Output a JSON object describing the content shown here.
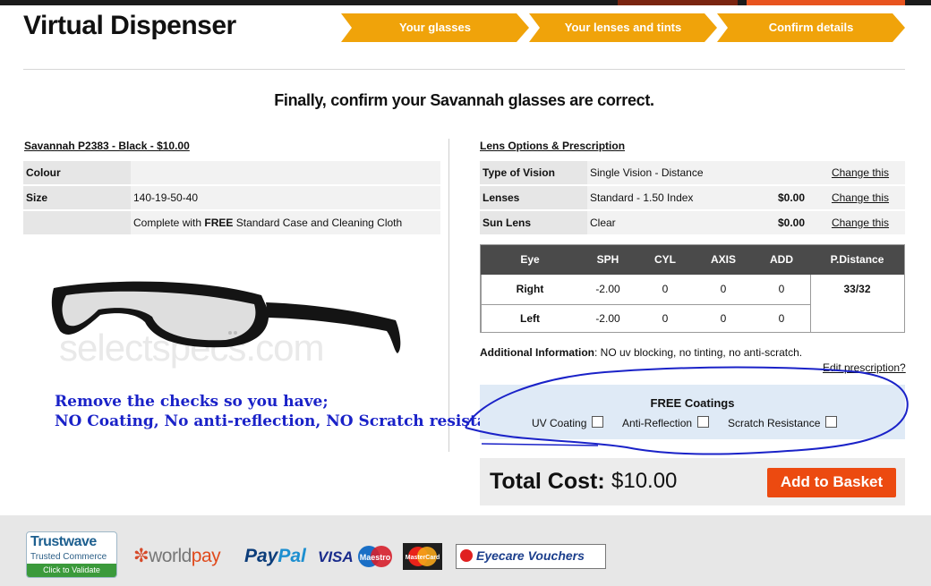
{
  "header": {
    "title": "Virtual Dispenser",
    "steps": [
      "Your glasses",
      "Your lenses and tints",
      "Confirm details"
    ]
  },
  "headline": "Finally, confirm your Savannah glasses are correct.",
  "frame": {
    "title": "Savannah P2383 - Black - $10.00",
    "rows": [
      {
        "label": "Colour",
        "value": ""
      },
      {
        "label": "Size",
        "value": "140-19-50-40"
      },
      {
        "label": "",
        "value_pre": "Complete with ",
        "value_bold": "FREE",
        "value_post": " Standard Case and Cleaning Cloth"
      }
    ],
    "watermark": "selectspecs.com"
  },
  "annotation": {
    "line1": "Remove the checks so you have;",
    "line2": "NO Coating, No anti-reflection, NO Scratch resistance >"
  },
  "lens": {
    "title": "Lens Options & Prescription",
    "rows": [
      {
        "label": "Type of Vision",
        "value": "Single Vision - Distance",
        "price": "",
        "link": "Change this"
      },
      {
        "label": "Lenses",
        "value": "Standard - 1.50 Index",
        "price": "$0.00",
        "link": "Change this"
      },
      {
        "label": "Sun Lens",
        "value": "Clear",
        "price": "$0.00",
        "link": "Change this"
      }
    ]
  },
  "prescription": {
    "headers": [
      "Eye",
      "SPH",
      "CYL",
      "AXIS",
      "ADD",
      "P.Distance"
    ],
    "rows": [
      {
        "eye": "Right",
        "sph": "-2.00",
        "cyl": "0",
        "axis": "0",
        "add": "0"
      },
      {
        "eye": "Left",
        "sph": "-2.00",
        "cyl": "0",
        "axis": "0",
        "add": "0"
      }
    ],
    "pd": "33/32"
  },
  "additional": {
    "label": "Additional Information",
    "text": ": NO uv blocking, no tinting, no anti-scratch.",
    "edit_link": "Edit prescription?"
  },
  "coatings": {
    "title": "FREE Coatings",
    "options": [
      {
        "label": "UV Coating",
        "checked": false
      },
      {
        "label": "Anti-Reflection",
        "checked": false
      },
      {
        "label": "Scratch Resistance",
        "checked": false
      }
    ]
  },
  "total": {
    "label": "Total Cost:",
    "value": "$10.00",
    "button": "Add to Basket"
  },
  "footer": {
    "trustwave": [
      "Trustwave",
      "Trusted Commerce",
      "Click to Validate"
    ],
    "worldpay": [
      "world",
      "pay"
    ],
    "paypal": [
      "Pay",
      "Pal"
    ],
    "visa": "VISA",
    "maestro": "Maestro",
    "mastercard": "MasterCard",
    "eyecare": "Eyecare Vouchers"
  },
  "colors": {
    "step_orange": "#f0a30a",
    "button_orange": "#ec4a10",
    "annotation_blue": "#1a22c8",
    "coat_bg": "#dfeaf6"
  }
}
